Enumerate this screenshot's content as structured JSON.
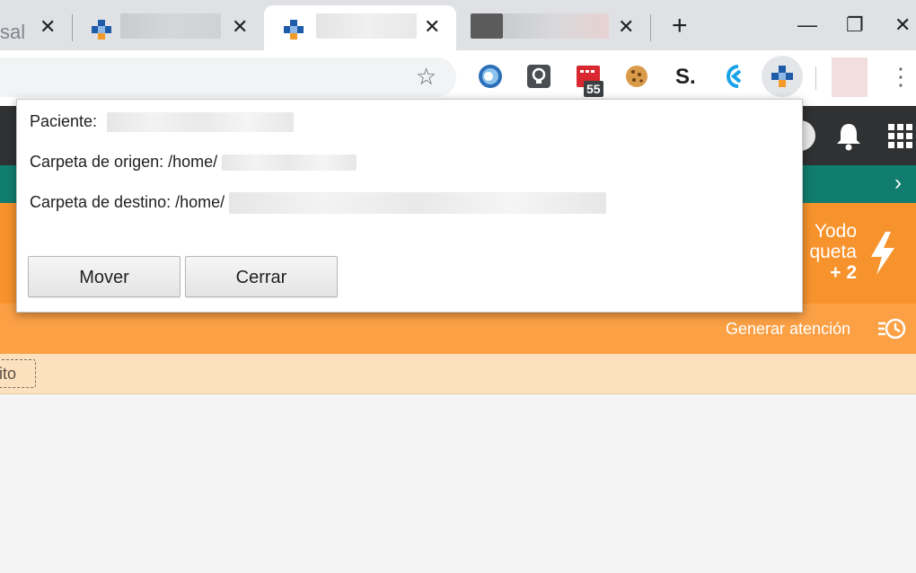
{
  "browser": {
    "tabs": [
      {
        "title": "sal",
        "close": "✕"
      },
      {
        "title": "",
        "close": "✕"
      },
      {
        "title": "",
        "close": "✕",
        "active": true
      },
      {
        "title": "",
        "close": "✕"
      }
    ],
    "new_tab": "+",
    "window_controls": {
      "minimize": "—",
      "maximize": "❐",
      "close": "✕"
    },
    "extension_badge": "55",
    "extension_s": "S.",
    "menu": "⋮",
    "star": "☆"
  },
  "page": {
    "side_widget": {
      "line1": "Yodo",
      "line2": "queta",
      "count": "+ 2"
    },
    "generar_atencion": "Generar atención",
    "chip_label": "ito"
  },
  "popup": {
    "paciente_label": "Paciente:",
    "origen_label": "Carpeta de origen: /home/",
    "destino_label": "Carpeta de destino: /home/",
    "mover_button": "Mover",
    "cerrar_button": "Cerrar"
  },
  "colors": {
    "teal": "#117d6e",
    "orange": "#f7932d",
    "light_orange": "#fba045",
    "peach": "#fde0bd",
    "dark_header": "#2f3133"
  }
}
